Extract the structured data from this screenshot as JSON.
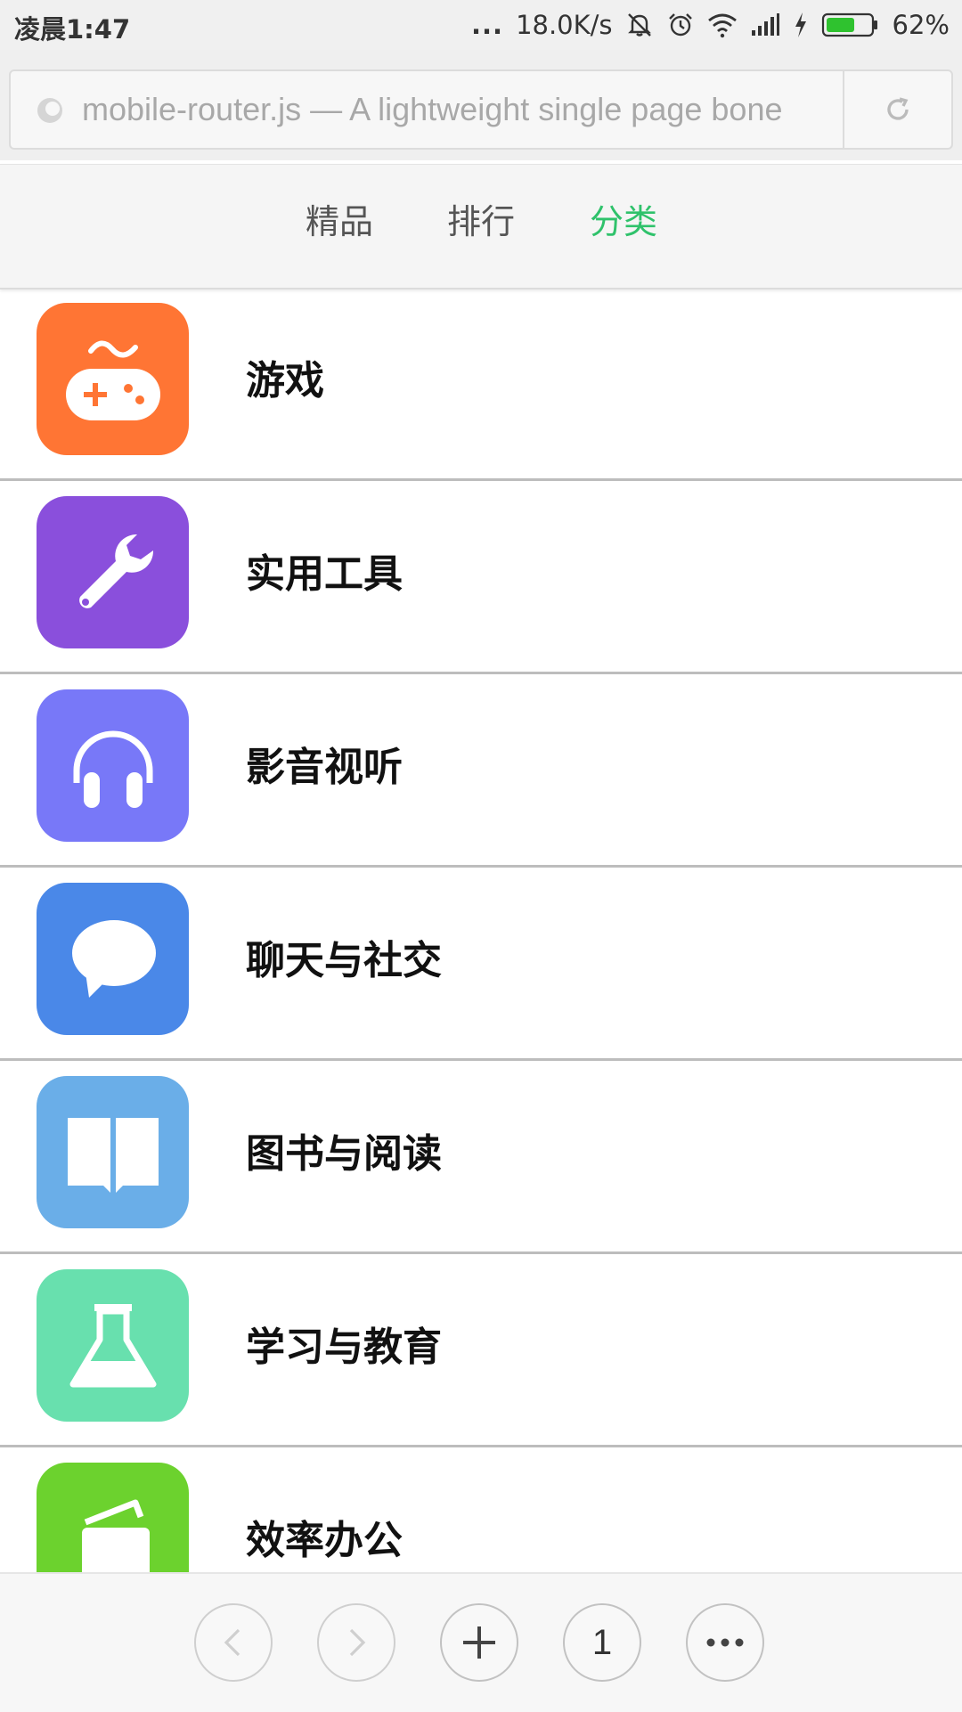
{
  "status_bar": {
    "time": "凌晨1:47",
    "dots": "...",
    "network_speed": "18.0K/s",
    "battery_percent": "62%",
    "battery_level": 0.62,
    "icons": [
      "silent-icon",
      "alarm-icon",
      "wifi-icon",
      "signal-icon",
      "charging-icon",
      "battery-icon"
    ]
  },
  "browser": {
    "url_text": "mobile-router.js — A lightweight single page bone"
  },
  "tabs": [
    {
      "label": "精品",
      "active": false
    },
    {
      "label": "排行",
      "active": false
    },
    {
      "label": "分类",
      "active": true
    }
  ],
  "colors": {
    "active_tab": "#2fc26b"
  },
  "categories": [
    {
      "label": "游戏",
      "icon": "gamepad-icon",
      "color": "#ff7534"
    },
    {
      "label": "实用工具",
      "icon": "wrench-icon",
      "color": "#8a4fdc"
    },
    {
      "label": "影音视听",
      "icon": "headphones-icon",
      "color": "#7878f8"
    },
    {
      "label": "聊天与社交",
      "icon": "chat-bubble-icon",
      "color": "#4a88e8"
    },
    {
      "label": "图书与阅读",
      "icon": "book-icon",
      "color": "#6aaee8"
    },
    {
      "label": "学习与教育",
      "icon": "flask-icon",
      "color": "#68e0ae"
    },
    {
      "label": "效率办公",
      "icon": "notebook-icon",
      "color": "#6cd22e"
    }
  ],
  "bottom_bar": {
    "tab_count": "1",
    "buttons": [
      "back-icon",
      "forward-icon",
      "new-tab-icon",
      "tab-count",
      "more-icon"
    ]
  }
}
